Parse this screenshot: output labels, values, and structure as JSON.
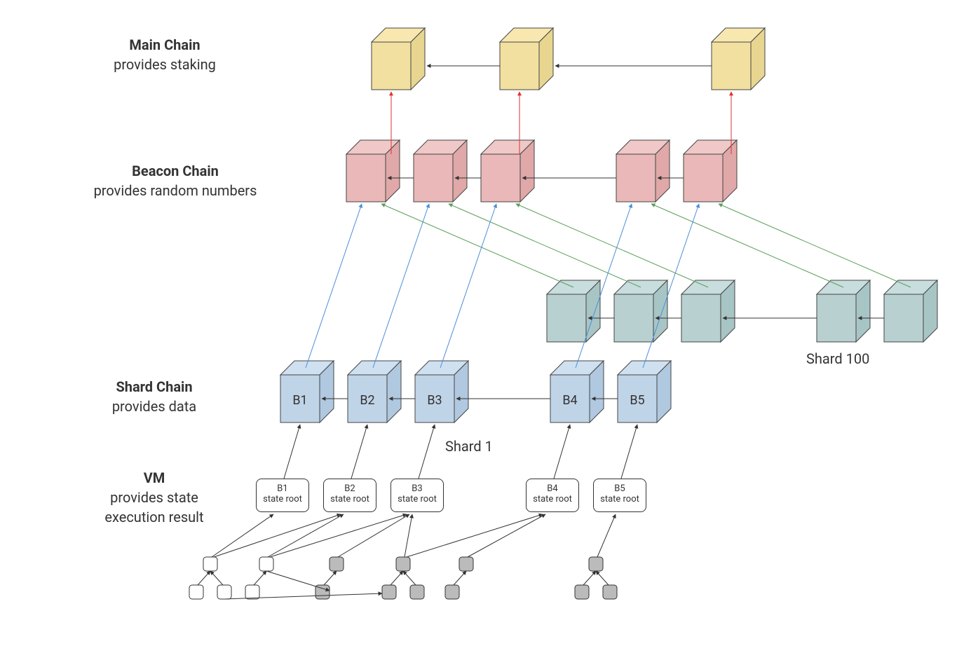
{
  "labels": {
    "main": {
      "title": "Main Chain",
      "sub": "provides staking"
    },
    "beacon": {
      "title": "Beacon Chain",
      "sub": "provides random numbers"
    },
    "shard": {
      "title": "Shard Chain",
      "sub": "provides data"
    },
    "vm": {
      "title": "VM",
      "sub": "provides state",
      "sub2": "execution result"
    }
  },
  "shard1": {
    "blocks": [
      "B1",
      "B2",
      "B3",
      "B4",
      "B5"
    ],
    "label": "Shard 1"
  },
  "shard100": {
    "label": "Shard 100"
  },
  "stateroots": [
    {
      "b": "B1",
      "t": "state root"
    },
    {
      "b": "B2",
      "t": "state root"
    },
    {
      "b": "B3",
      "t": "state root"
    },
    {
      "b": "B4",
      "t": "state root"
    },
    {
      "b": "B5",
      "t": "state root"
    }
  ],
  "colors": {
    "main": {
      "top": "#f8e8b0",
      "left": "#f2e0a0",
      "right": "#e8d590"
    },
    "beacon": {
      "top": "#f0c8c8",
      "left": "#eab8b8",
      "right": "#e0a8a8"
    },
    "shard100": {
      "top": "#c8dddd",
      "left": "#b8d0d0",
      "right": "#a8c5c5"
    },
    "shard1": {
      "top": "#cfe0f0",
      "left": "#c0d4e8",
      "right": "#b0c8e0"
    }
  }
}
